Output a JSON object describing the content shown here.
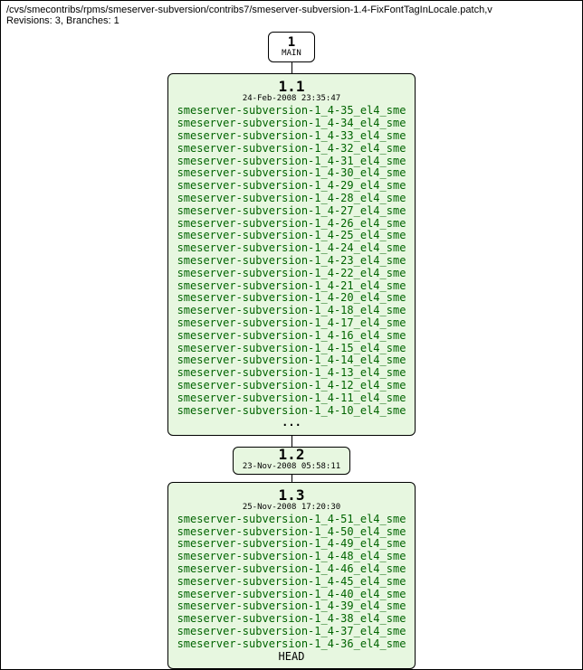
{
  "header": {
    "path": "/cvs/smecontribs/rpms/smeserver-subversion/contribs7/smeserver-subversion-1.4-FixFontTagInLocale.patch,v",
    "revisions_line": "Revisions: 3, Branches: 1"
  },
  "branch": {
    "number": "1",
    "name": "MAIN"
  },
  "rev11": {
    "number": "1.1",
    "date": "24-Feb-2008 23:35:47",
    "tags": [
      "smeserver-subversion-1_4-35_el4_sme",
      "smeserver-subversion-1_4-34_el4_sme",
      "smeserver-subversion-1_4-33_el4_sme",
      "smeserver-subversion-1_4-32_el4_sme",
      "smeserver-subversion-1_4-31_el4_sme",
      "smeserver-subversion-1_4-30_el4_sme",
      "smeserver-subversion-1_4-29_el4_sme",
      "smeserver-subversion-1_4-28_el4_sme",
      "smeserver-subversion-1_4-27_el4_sme",
      "smeserver-subversion-1_4-26_el4_sme",
      "smeserver-subversion-1_4-25_el4_sme",
      "smeserver-subversion-1_4-24_el4_sme",
      "smeserver-subversion-1_4-23_el4_sme",
      "smeserver-subversion-1_4-22_el4_sme",
      "smeserver-subversion-1_4-21_el4_sme",
      "smeserver-subversion-1_4-20_el4_sme",
      "smeserver-subversion-1_4-18_el4_sme",
      "smeserver-subversion-1_4-17_el4_sme",
      "smeserver-subversion-1_4-16_el4_sme",
      "smeserver-subversion-1_4-15_el4_sme",
      "smeserver-subversion-1_4-14_el4_sme",
      "smeserver-subversion-1_4-13_el4_sme",
      "smeserver-subversion-1_4-12_el4_sme",
      "smeserver-subversion-1_4-11_el4_sme",
      "smeserver-subversion-1_4-10_el4_sme"
    ],
    "ellipsis": "..."
  },
  "rev12": {
    "number": "1.2",
    "date": "23-Nov-2008 05:58:11"
  },
  "rev13": {
    "number": "1.3",
    "date": "25-Nov-2008 17:20:30",
    "tags": [
      "smeserver-subversion-1_4-51_el4_sme",
      "smeserver-subversion-1_4-50_el4_sme",
      "smeserver-subversion-1_4-49_el4_sme",
      "smeserver-subversion-1_4-48_el4_sme",
      "smeserver-subversion-1_4-46_el4_sme",
      "smeserver-subversion-1_4-45_el4_sme",
      "smeserver-subversion-1_4-40_el4_sme",
      "smeserver-subversion-1_4-39_el4_sme",
      "smeserver-subversion-1_4-38_el4_sme",
      "smeserver-subversion-1_4-37_el4_sme",
      "smeserver-subversion-1_4-36_el4_sme"
    ],
    "head": "HEAD"
  }
}
